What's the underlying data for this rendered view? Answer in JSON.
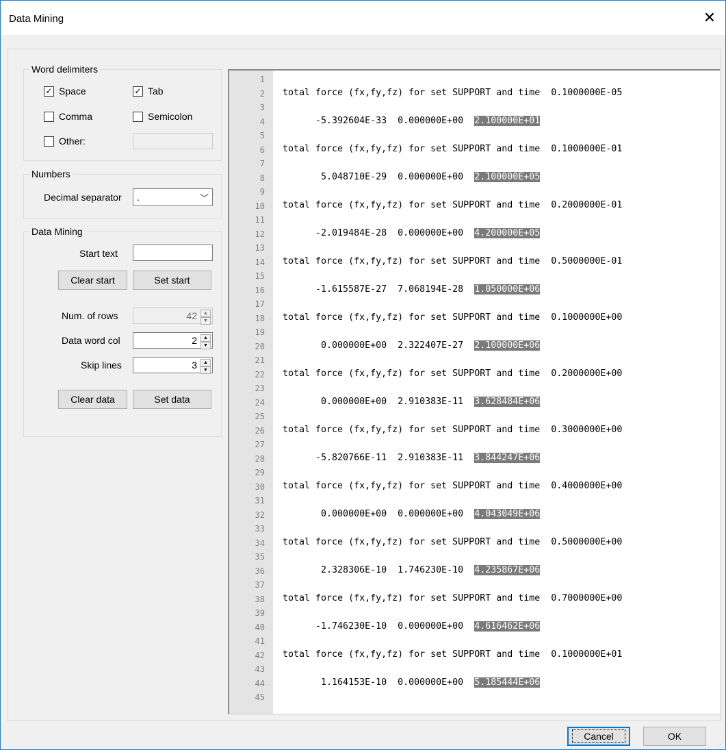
{
  "window": {
    "title": "Data Mining",
    "close_glyph": "✕"
  },
  "word_delimiters": {
    "title": "Word delimiters",
    "space": {
      "label": "Space",
      "checked": true
    },
    "tab": {
      "label": "Tab",
      "checked": true
    },
    "comma": {
      "label": "Comma",
      "checked": false
    },
    "semicolon": {
      "label": "Semicolon",
      "checked": false
    },
    "other": {
      "label": "Other:",
      "checked": false,
      "value": ""
    }
  },
  "numbers": {
    "title": "Numbers",
    "decimal_separator_label": "Decimal separator",
    "decimal_separator_value": "."
  },
  "data_mining": {
    "title": "Data Mining",
    "start_text_label": "Start text",
    "start_text_value": "",
    "clear_start": "Clear start",
    "set_start": "Set start",
    "num_rows_label": "Num. of rows",
    "num_rows_value": "42",
    "data_word_col_label": "Data word col",
    "data_word_col_value": "2",
    "skip_lines_label": "Skip lines",
    "skip_lines_value": "3",
    "clear_data": "Clear data",
    "set_data": "Set data"
  },
  "editor": {
    "line_numbers": [
      "1",
      "2",
      "3",
      "4",
      "5",
      "6",
      "7",
      "8",
      "9",
      "10",
      "11",
      "12",
      "13",
      "14",
      "15",
      "16",
      "17",
      "18",
      "19",
      "20",
      "21",
      "22",
      "23",
      "24",
      "25",
      "26",
      "27",
      "28",
      "29",
      "30",
      "31",
      "32",
      "33",
      "34",
      "35",
      "36",
      "37",
      "38",
      "39",
      "40",
      "41",
      "42",
      "43",
      "44",
      "45"
    ],
    "header_text": "total force (fx,fy,fz) for set SUPPORT and time",
    "blocks": [
      {
        "time": "0.1000000E-05",
        "prefix": "      -5.392604E-33  0.000000E+00  ",
        "value": "2.100000E+01"
      },
      {
        "time": "0.1000000E-01",
        "prefix": "       5.048710E-29  0.000000E+00  ",
        "value": "2.100000E+05"
      },
      {
        "time": "0.2000000E-01",
        "prefix": "      -2.019484E-28  0.000000E+00  ",
        "value": "4.200000E+05"
      },
      {
        "time": "0.5000000E-01",
        "prefix": "      -1.615587E-27  7.068194E-28  ",
        "value": "1.050000E+06"
      },
      {
        "time": "0.1000000E+00",
        "prefix": "       0.000000E+00  2.322407E-27  ",
        "value": "2.100000E+06"
      },
      {
        "time": "0.2000000E+00",
        "prefix": "       0.000000E+00  2.910383E-11  ",
        "value": "3.628484E+06"
      },
      {
        "time": "0.3000000E+00",
        "prefix": "      -5.820766E-11  2.910383E-11  ",
        "value": "3.844247E+06"
      },
      {
        "time": "0.4000000E+00",
        "prefix": "       0.000000E+00  0.000000E+00  ",
        "value": "4.043049E+06"
      },
      {
        "time": "0.5000000E+00",
        "prefix": "       2.328306E-10  1.746230E-10  ",
        "value": "4.235867E+06"
      },
      {
        "time": "0.7000000E+00",
        "prefix": "      -1.746230E-10  0.000000E+00  ",
        "value": "4.616462E+06"
      },
      {
        "time": "0.1000000E+01",
        "prefix": "       1.164153E-10  0.000000E+00  ",
        "value": "5.185444E+06"
      }
    ]
  },
  "footer": {
    "cancel": "Cancel",
    "ok": "OK"
  }
}
